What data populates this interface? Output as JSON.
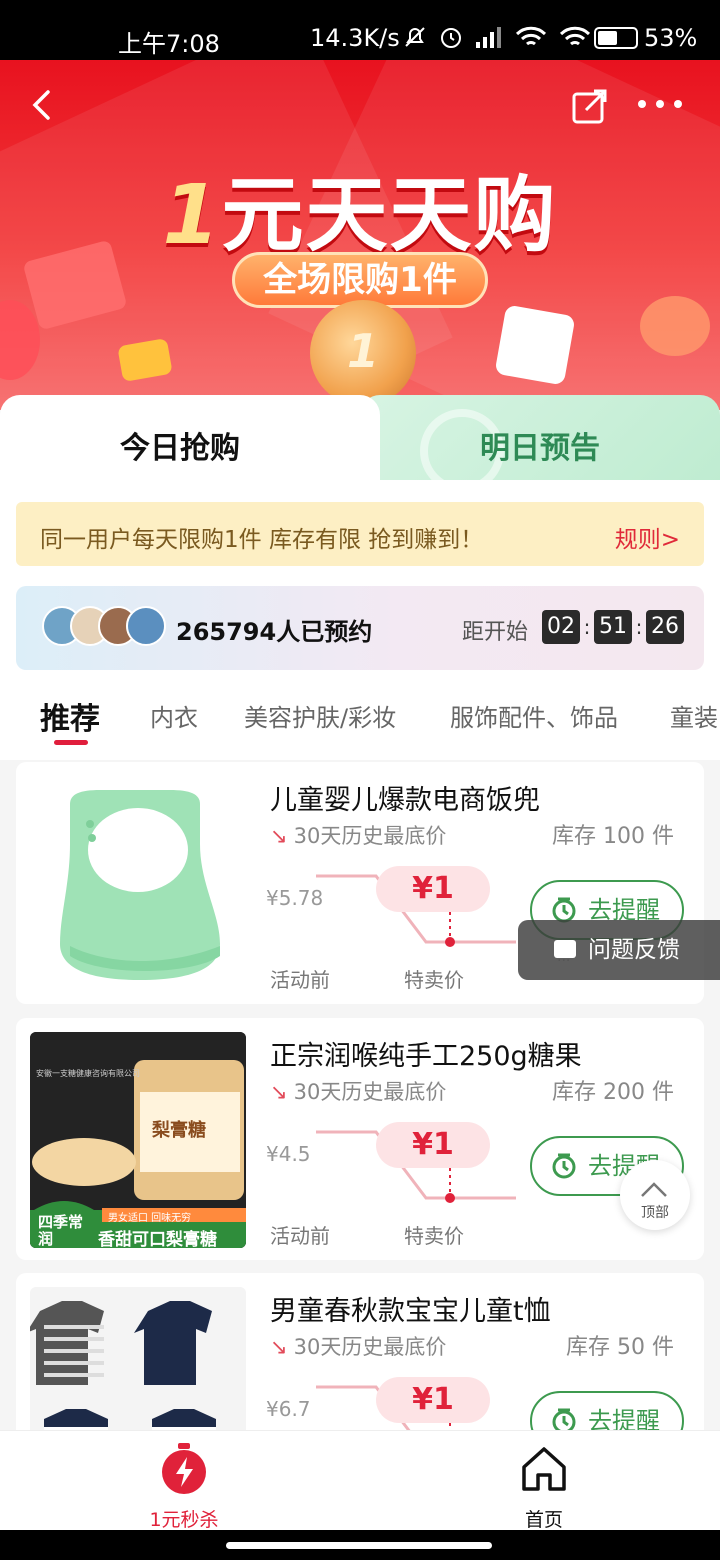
{
  "status_bar": {
    "time": "上午7:08",
    "net_speed": "14.3K/s",
    "battery": "53%",
    "battery_level": 0.53
  },
  "banner": {
    "title_num": "1",
    "title_text": "元天天购",
    "subtitle": "全场限购1件",
    "coin_text": "1"
  },
  "tabs": {
    "today": "今日抢购",
    "tomorrow": "明日预告"
  },
  "notice": {
    "text": "同一用户每天限购1件 库存有限 抢到赚到！",
    "rule": "规则>"
  },
  "reserve": {
    "count_text": "265794人已预约",
    "until_label": "距开始",
    "hours": "02",
    "minutes": "51",
    "seconds": "26"
  },
  "categories": [
    "推荐",
    "内衣",
    "美容护肤/彩妆",
    "服饰配件、饰品",
    "童装"
  ],
  "products": [
    {
      "name": "儿童婴儿爆款电商饭兜",
      "history": "30天历史最底价",
      "stock": "库存 100 件",
      "prev_price": "¥5.78",
      "price": "¥1",
      "label_before": "活动前",
      "label_sale": "特卖价",
      "remind": "去提醒"
    },
    {
      "name": "正宗润喉纯手工250g糖果",
      "history": "30天历史最底价",
      "stock": "库存 200 件",
      "prev_price": "¥4.5",
      "price": "¥1",
      "label_before": "活动前",
      "label_sale": "特卖价",
      "remind": "去提醒",
      "image_texts": {
        "company": "安徽一支糖健康咨询有限公司",
        "jar_label": "梨膏糖",
        "badge": "四季常润",
        "banner_small": "男女适口 回味无穷",
        "banner_big": "香甜可口梨膏糖"
      }
    },
    {
      "name": "男童春秋款宝宝儿童t恤",
      "history": "30天历史最底价",
      "stock": "库存 50 件",
      "prev_price": "¥6.7",
      "price": "¥1",
      "remind": "去提醒"
    }
  ],
  "feedback": "问题反馈",
  "back_to_top": "顶部",
  "bottom_nav": {
    "flash_sale": "1元秒杀",
    "home": "首页"
  },
  "colors": {
    "brand_red": "#e0223a",
    "remind_green": "#3d9a4f"
  }
}
